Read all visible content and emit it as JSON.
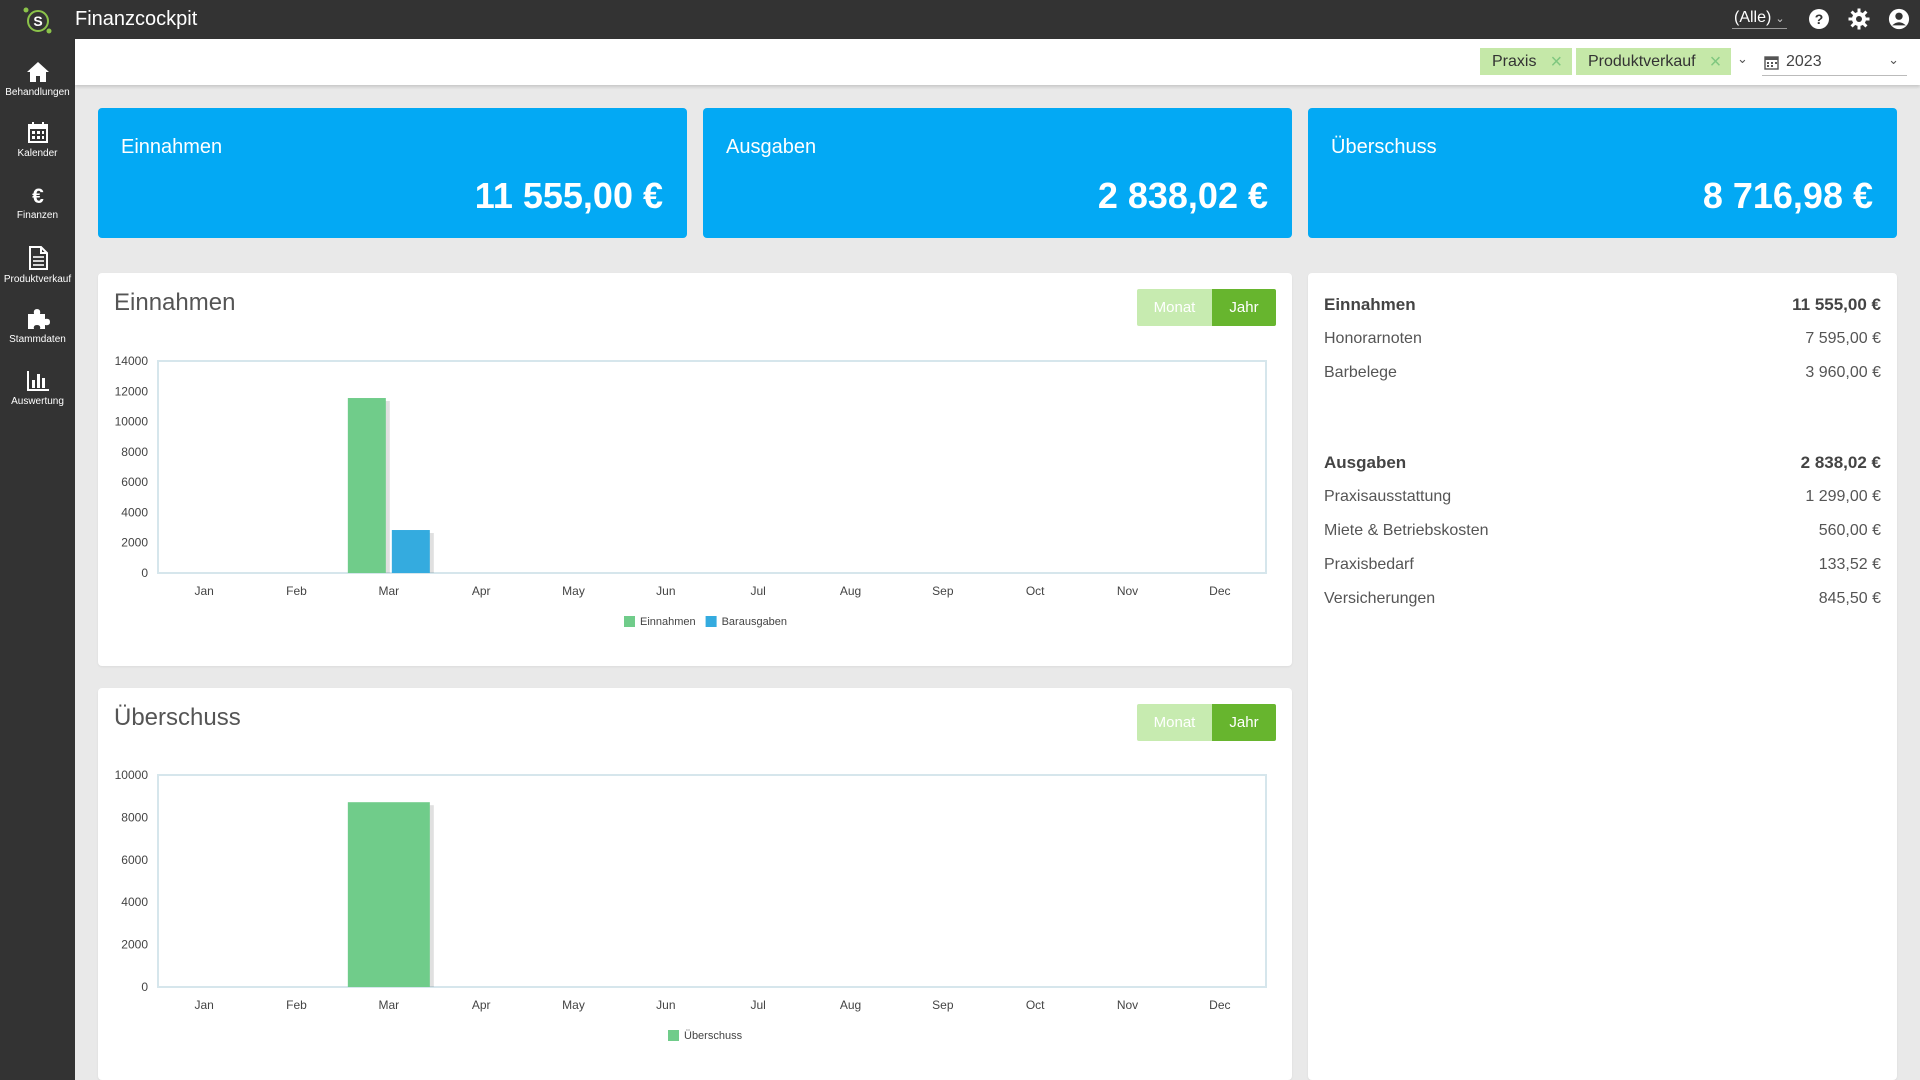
{
  "app": {
    "title": "Finanzcockpit"
  },
  "topbar": {
    "filter_value": "(Alle)"
  },
  "sidebar": {
    "items": [
      {
        "label": "Behandlungen",
        "icon": "home-icon"
      },
      {
        "label": "Kalender",
        "icon": "calendar-icon"
      },
      {
        "label": "Finanzen",
        "icon": "euro-icon"
      },
      {
        "label": "Produktverkauf",
        "icon": "document-icon"
      },
      {
        "label": "Stammdaten",
        "icon": "puzzle-icon"
      },
      {
        "label": "Auswertung",
        "icon": "bar-chart-icon"
      }
    ]
  },
  "filters": {
    "chips": [
      "Praxis",
      "Produktverkauf"
    ],
    "year": "2023"
  },
  "kpis": [
    {
      "label": "Einnahmen",
      "value": "11 555,00 €"
    },
    {
      "label": "Ausgaben",
      "value": "2 838,02 €"
    },
    {
      "label": "Überschuss",
      "value": "8 716,98 €"
    }
  ],
  "colors": {
    "accent": "#03a9f4",
    "income": "#70cc8a",
    "expense": "#34abdf",
    "toggle_active": "#67b52e",
    "toggle_inactive": "#c7ebb0",
    "sidebar": "#333333"
  },
  "income_card": {
    "title": "Einnahmen",
    "toggle": {
      "month": "Monat",
      "year": "Jahr"
    }
  },
  "surplus_card": {
    "title": "Überschuss",
    "toggle": {
      "month": "Monat",
      "year": "Jahr"
    }
  },
  "chart_data": [
    {
      "type": "bar",
      "title": "Einnahmen",
      "categories": [
        "Jan",
        "Feb",
        "Mar",
        "Apr",
        "May",
        "Jun",
        "Jul",
        "Aug",
        "Sep",
        "Oct",
        "Nov",
        "Dec"
      ],
      "series": [
        {
          "name": "Einnahmen",
          "values": [
            0,
            0,
            11555,
            0,
            0,
            0,
            0,
            0,
            0,
            0,
            0,
            0
          ]
        },
        {
          "name": "Barausgaben",
          "values": [
            0,
            0,
            2838,
            0,
            0,
            0,
            0,
            0,
            0,
            0,
            0,
            0
          ]
        }
      ],
      "yticks": [
        0,
        2000,
        4000,
        6000,
        8000,
        10000,
        12000,
        14000
      ],
      "ylim": [
        0,
        14000
      ],
      "legend": "bottom"
    },
    {
      "type": "bar",
      "title": "Überschuss",
      "categories": [
        "Jan",
        "Feb",
        "Mar",
        "Apr",
        "May",
        "Jun",
        "Jul",
        "Aug",
        "Sep",
        "Oct",
        "Nov",
        "Dec"
      ],
      "series": [
        {
          "name": "Überschuss",
          "values": [
            0,
            0,
            8717,
            0,
            0,
            0,
            0,
            0,
            0,
            0,
            0,
            0
          ]
        }
      ],
      "yticks": [
        0,
        2000,
        4000,
        6000,
        8000,
        10000
      ],
      "ylim": [
        0,
        10000
      ],
      "legend": "bottom"
    }
  ],
  "summary": {
    "income": {
      "label": "Einnahmen",
      "total": "11 555,00 €",
      "items": [
        {
          "label": "Honorarnoten",
          "amount": "7 595,00 €"
        },
        {
          "label": "Barbelege",
          "amount": "3 960,00 €"
        }
      ]
    },
    "expenses": {
      "label": "Ausgaben",
      "total": "2 838,02 €",
      "items": [
        {
          "label": "Praxisausstattung",
          "amount": "1 299,00 €"
        },
        {
          "label": "Miete & Betriebskosten",
          "amount": "560,00 €"
        },
        {
          "label": "Praxisbedarf",
          "amount": "133,52 €"
        },
        {
          "label": "Versicherungen",
          "amount": "845,50 €"
        }
      ]
    }
  }
}
